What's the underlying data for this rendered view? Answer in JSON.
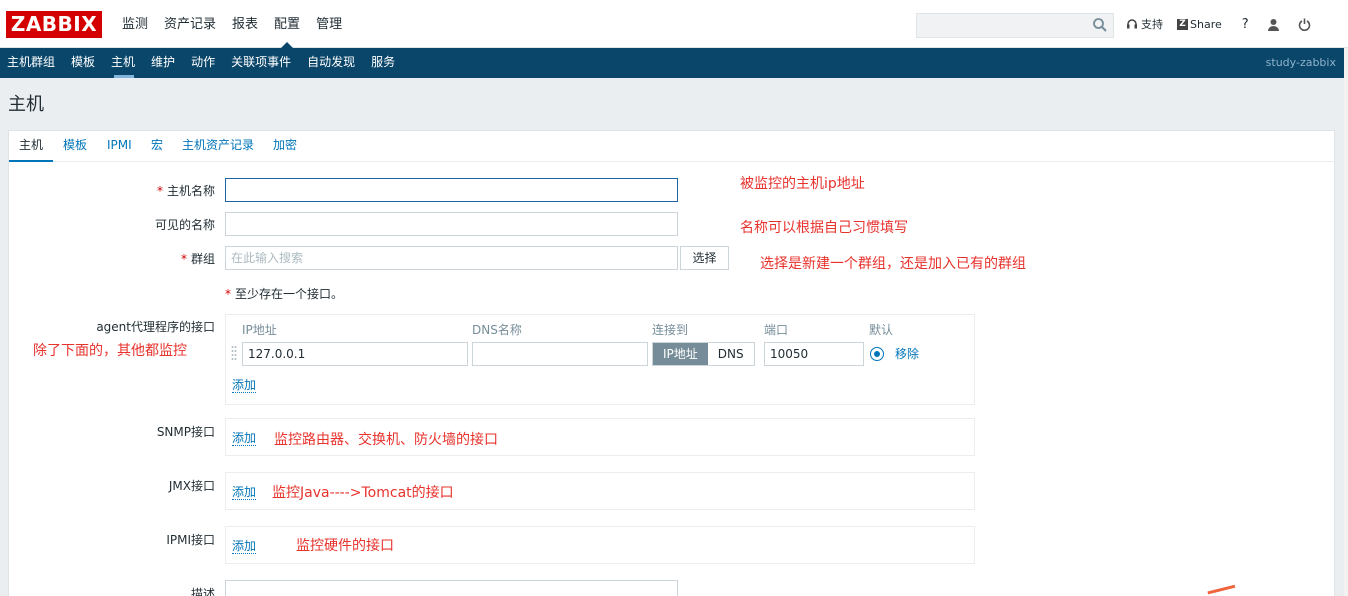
{
  "header": {
    "logo": "ZABBIX",
    "menu": [
      "监测",
      "资产记录",
      "报表",
      "配置",
      "管理"
    ],
    "active_menu": 3,
    "search": {
      "placeholder": ""
    },
    "support": "支持",
    "share": "Share",
    "help": "?"
  },
  "subnav": {
    "items": [
      "主机群组",
      "模板",
      "主机",
      "维护",
      "动作",
      "关联项事件",
      "自动发现",
      "服务"
    ],
    "active": 2,
    "server": "study-zabbix"
  },
  "page": {
    "title": "主机"
  },
  "tabs": [
    "主机",
    "模板",
    "IPMI",
    "宏",
    "主机资产记录",
    "加密"
  ],
  "form": {
    "host_name": {
      "label": "主机名称",
      "value": ""
    },
    "visible_name": {
      "label": "可见的名称",
      "value": ""
    },
    "groups": {
      "label": "群组",
      "placeholder": "在此输入搜索",
      "select": "选择"
    },
    "note": "至少存在一个接口。",
    "agent": {
      "label": "agent代理程序的接口",
      "col_ip": "IP地址",
      "col_dns": "DNS名称",
      "col_connect": "连接到",
      "col_port": "端口",
      "col_default": "默认",
      "ip": "127.0.0.1",
      "dns": "",
      "connect_ip": "IP地址",
      "connect_dns": "DNS",
      "port": "10050",
      "remove": "移除",
      "add": "添加"
    },
    "snmp": {
      "label": "SNMP接口",
      "add": "添加"
    },
    "jmx": {
      "label": "JMX接口",
      "add": "添加"
    },
    "ipmi": {
      "label": "IPMI接口",
      "add": "添加"
    },
    "desc": {
      "label": "描述"
    }
  },
  "annotations": {
    "a1": "被监控的主机ip地址",
    "a2": "名称可以根据自己习惯填写",
    "a3": "选择是新建一个群组，还是加入已有的群组",
    "a4": "除了下面的，其他都监控",
    "a5": "监控路由器、交换机、防火墙的接口",
    "a6": "监控Java---->Tomcat的接口",
    "a7": "监控硬件的接口"
  },
  "colors": {
    "brand": "#d40000",
    "nav": "#0a466a",
    "link": "#0275b8",
    "annotation": "#e8322c"
  }
}
